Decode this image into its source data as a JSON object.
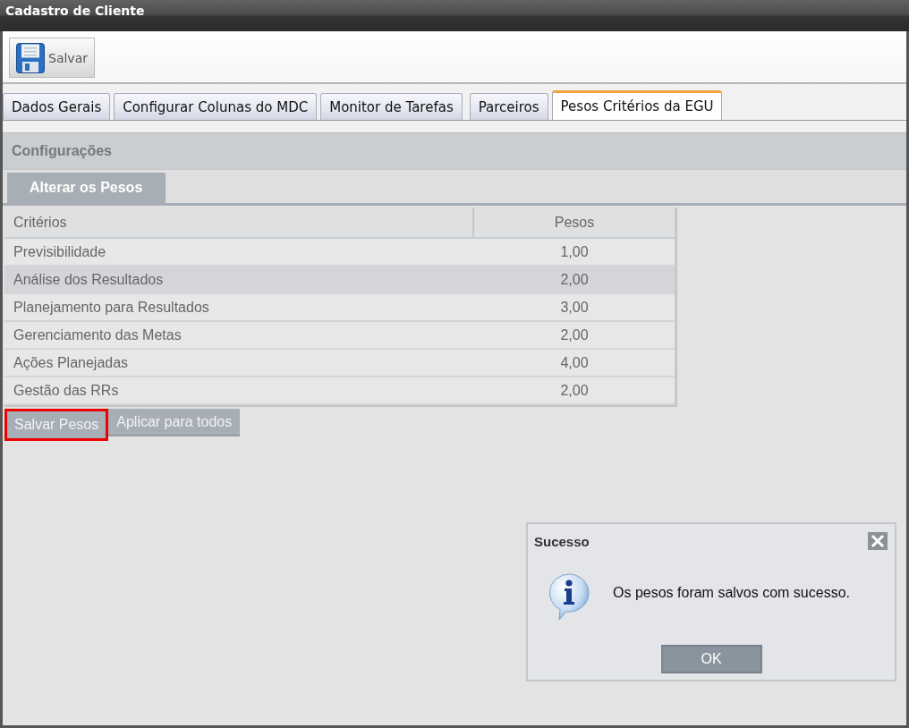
{
  "window": {
    "title": "Cadastro de Cliente"
  },
  "toolbar": {
    "buttons": [
      "Salvar"
    ]
  },
  "tabs": [
    {
      "label": "Dados Gerais",
      "selected": false
    },
    {
      "label": "Configurar Colunas do MDC",
      "selected": false
    },
    {
      "label": "Monitor de Tarefas",
      "selected": false
    },
    {
      "label": "Parceiros",
      "selected": false
    },
    {
      "label": "Pesos Critérios da EGU",
      "selected": true
    }
  ],
  "panel": {
    "title": "Configurações",
    "subtabs": [
      {
        "label": "Alterar os Pesos",
        "selected": true
      }
    ],
    "table": {
      "columns": [
        "Critérios",
        "Pesos"
      ],
      "rows": [
        {
          "cells": [
            "Previsibilidade",
            "1,00"
          ],
          "selected": false
        },
        {
          "cells": [
            "Análise dos Resultados",
            "2,00"
          ],
          "selected": true
        },
        {
          "cells": [
            "Planejamento para Resultados",
            "3,00"
          ],
          "selected": false
        },
        {
          "cells": [
            "Gerenciamento das Metas",
            "2,00"
          ],
          "selected": false
        },
        {
          "cells": [
            "Ações Planejadas",
            "4,00"
          ],
          "selected": false
        },
        {
          "cells": [
            "Gestão das RRs",
            "2,00"
          ],
          "selected": false
        }
      ]
    },
    "buttons": [
      {
        "label": "Salvar Pesos",
        "highlighted": true
      },
      {
        "label": "Aplicar para todos",
        "highlighted": false
      }
    ]
  },
  "dialog": {
    "title": "Sucesso",
    "message": "Os pesos foram salvos com sucesso.",
    "buttons": [
      "OK"
    ]
  }
}
